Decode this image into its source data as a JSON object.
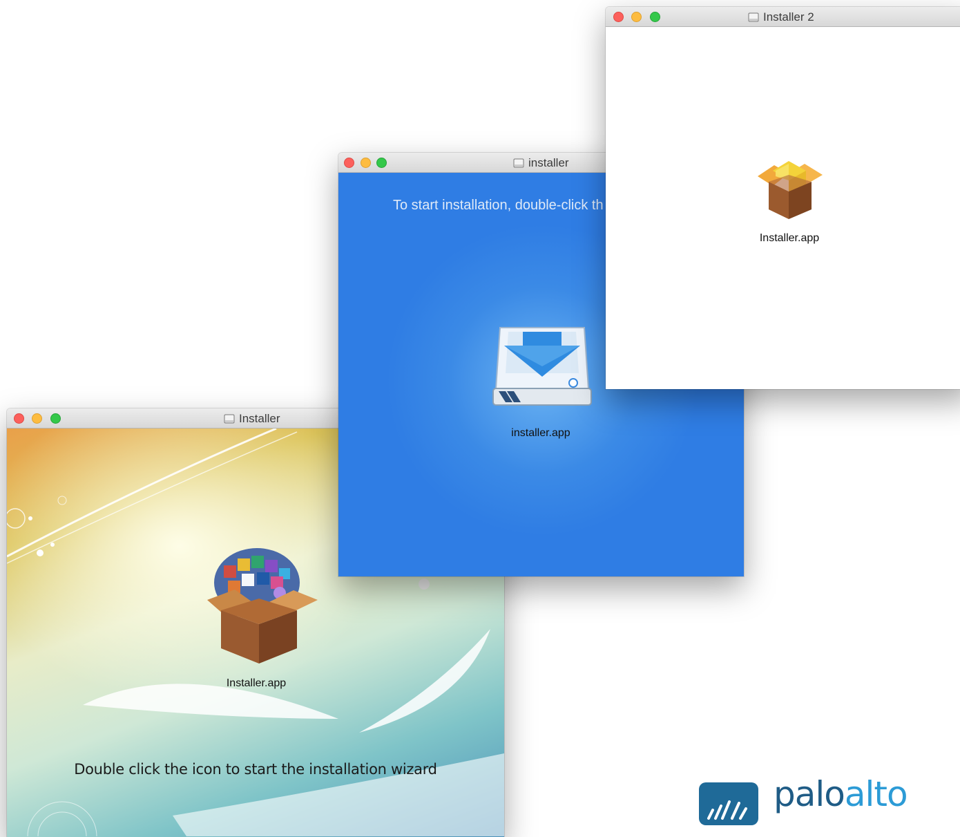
{
  "windows": {
    "installer": {
      "title": "Installer",
      "app_label": "Installer.app",
      "instruction": "Double click the icon to start the installation wizard"
    },
    "installer_blue": {
      "title": "installer",
      "instruction": "To start installation, double-click th",
      "app_label": "installer.app"
    },
    "installer2": {
      "title": "Installer 2",
      "app_label": "Installer.app"
    }
  },
  "logo": {
    "part1": "palo",
    "part2": "alto",
    "colors": {
      "dark": "#1f5c86",
      "light": "#2c9bd6"
    }
  },
  "colors": {
    "blue_window_bg": "#2f7de4",
    "close": "#fc605c",
    "minimize": "#fdbc40",
    "zoom": "#34c84a"
  }
}
